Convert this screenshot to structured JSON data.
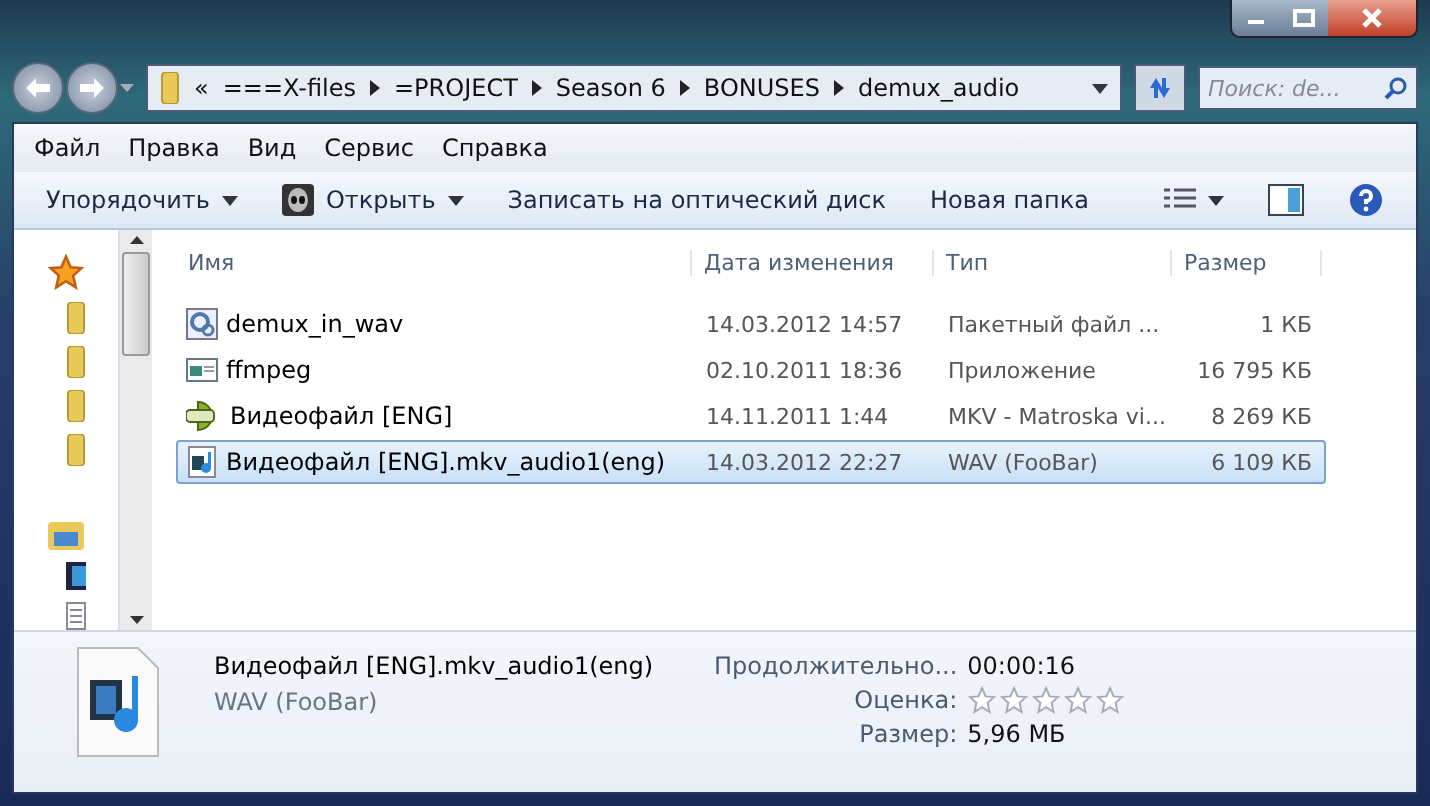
{
  "address": {
    "segments": [
      "«",
      "===X-files",
      "=PROJECT",
      "Season 6",
      "BONUSES",
      "demux_audio"
    ]
  },
  "search": {
    "placeholder": "Поиск: de..."
  },
  "menu": [
    "Файл",
    "Правка",
    "Вид",
    "Сервис",
    "Справка"
  ],
  "toolbar": [
    {
      "label": "Упорядочить",
      "kind": "dropdown"
    },
    {
      "label": "Открыть",
      "kind": "open"
    },
    {
      "label": "Записать на оптический диск",
      "kind": "plain"
    },
    {
      "label": "Новая папка",
      "kind": "plain"
    }
  ],
  "columns": [
    "Имя",
    "Дата изменения",
    "Тип",
    "Размер"
  ],
  "rows": [
    {
      "name": "demux_in_wav",
      "date": "14.03.2012 14:57",
      "type": "Пакетный файл ...",
      "size": "1 КБ",
      "kind": "batch",
      "selected": false
    },
    {
      "name": "ffmpeg",
      "date": "02.10.2011 18:36",
      "type": "Приложение",
      "size": "16 795 КБ",
      "kind": "app",
      "selected": false
    },
    {
      "name": "Видеофайл [ENG]",
      "date": "14.11.2011 1:44",
      "type": "MKV - Matroska vi...",
      "size": "8 269 КБ",
      "kind": "mkv",
      "selected": false
    },
    {
      "name": "Видеофайл [ENG].mkv_audio1(eng)",
      "date": "14.03.2012 22:27",
      "type": "WAV (FooBar)",
      "size": "6 109 КБ",
      "kind": "wav",
      "selected": true
    }
  ],
  "details": {
    "name": "Видеофайл [ENG].mkv_audio1(eng)",
    "type": "WAV (FooBar)",
    "props": [
      {
        "label": "Продолжительно...",
        "value": "00:00:16",
        "kind": "text"
      },
      {
        "label": "Оценка:",
        "stars": 0,
        "kind": "rating"
      },
      {
        "label": "Размер:",
        "value": "5,96 МБ",
        "kind": "text"
      }
    ]
  }
}
